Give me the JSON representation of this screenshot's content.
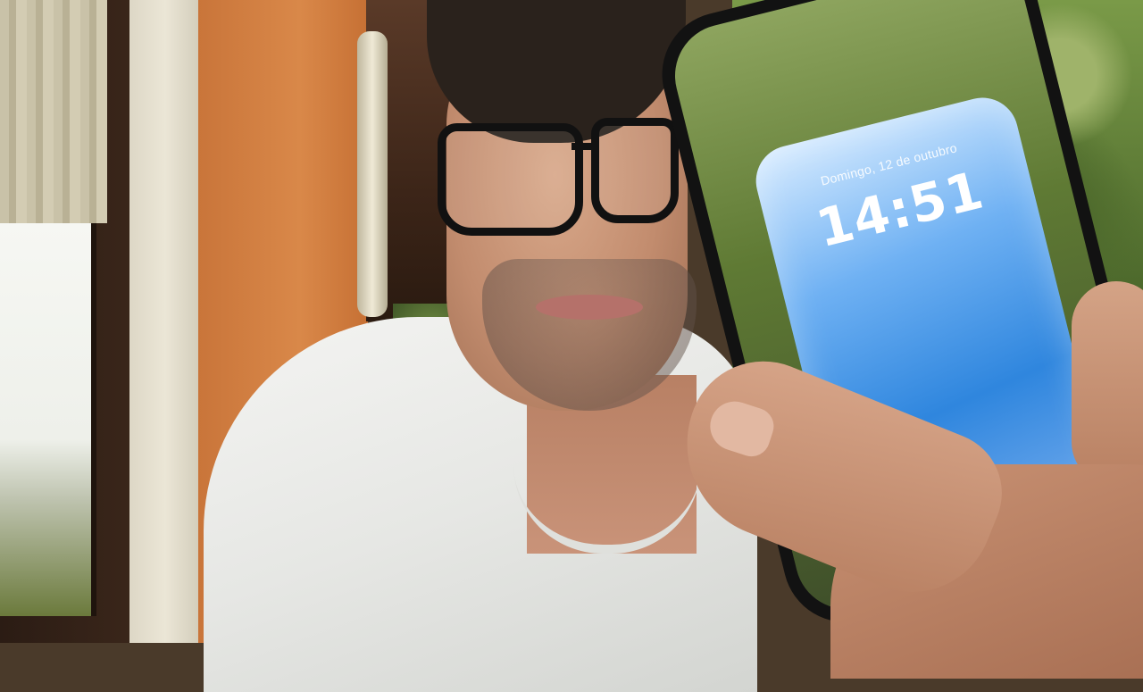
{
  "phone": {
    "lock_screen": {
      "date": "Domingo, 12 de outubro",
      "time": "14:51"
    }
  },
  "colors": {
    "lock_screen_blue": "#2f86de",
    "phone_case": "#121212",
    "shirt": "#f4f4f2",
    "orange_wall": "#d98849"
  }
}
